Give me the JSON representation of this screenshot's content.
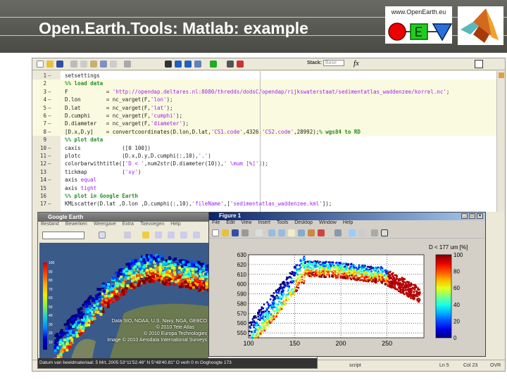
{
  "slide": {
    "title": "Open.Earth.Tools: Matlab: example",
    "logo_text": "www.OpenEarth.eu"
  },
  "editor": {
    "toolbar": {
      "stack_label": "Stack:",
      "stack_value": "Base",
      "fx": "fx"
    },
    "lines": [
      {
        "n": "1",
        "dash": "—",
        "cell": false,
        "seg": [
          [
            "setsettings",
            ""
          ]
        ]
      },
      {
        "n": "2",
        "dash": "",
        "cell": true,
        "seg": [
          [
            "%% load data",
            "cm"
          ]
        ]
      },
      {
        "n": "3",
        "dash": "—",
        "cell": true,
        "seg": [
          [
            "F            = ",
            ""
          ],
          [
            "'http://opendap.deltares.nl:8080/thredds/dodsC/opendap/rijkswaterstaat/sedimentatlas_waddenzee/korrel.nc'",
            "st"
          ],
          [
            ";",
            ""
          ]
        ]
      },
      {
        "n": "4",
        "dash": "—",
        "cell": true,
        "seg": [
          [
            "D.lon        = nc_varget(F,",
            ""
          ],
          [
            "'lon'",
            "st"
          ],
          [
            ");",
            ""
          ]
        ]
      },
      {
        "n": "5",
        "dash": "—",
        "cell": true,
        "seg": [
          [
            "D.lat        = nc_varget(F,",
            ""
          ],
          [
            "'lat'",
            "st"
          ],
          [
            ");",
            ""
          ]
        ]
      },
      {
        "n": "6",
        "dash": "—",
        "cell": true,
        "seg": [
          [
            "D.cumphi     = nc_varget(F,",
            ""
          ],
          [
            "'cumphi'",
            "st"
          ],
          [
            ");",
            ""
          ]
        ]
      },
      {
        "n": "7",
        "dash": "—",
        "cell": true,
        "seg": [
          [
            "D.diameter   = nc_varget(F,",
            ""
          ],
          [
            "'diameter'",
            "st"
          ],
          [
            ");",
            ""
          ]
        ]
      },
      {
        "n": "8",
        "dash": "—",
        "cell": true,
        "seg": [
          [
            "[D.x,D.y]    = convertcoordinates(D.lon,D.lat,",
            ""
          ],
          [
            "'CS1.code'",
            "st"
          ],
          [
            ",4326,",
            ""
          ],
          [
            "'CS2.code'",
            "st"
          ],
          [
            ",28992);",
            ""
          ],
          [
            "% wgs84 to RD",
            "cm"
          ]
        ]
      },
      {
        "n": "9",
        "dash": "",
        "cell": false,
        "seg": [
          [
            "%% plot data",
            "cm"
          ]
        ]
      },
      {
        "n": "10",
        "dash": "—",
        "cell": false,
        "seg": [
          [
            "caxis             ([0 100])",
            ""
          ]
        ]
      },
      {
        "n": "11",
        "dash": "—",
        "cell": false,
        "seg": [
          [
            "plotc             (D.x,D.y,D.cumphi(:,10),",
            ""
          ],
          [
            "'.'",
            "st"
          ],
          [
            ")",
            ""
          ]
        ]
      },
      {
        "n": "12",
        "dash": "—",
        "cell": false,
        "seg": [
          [
            "colorbarwithtitle([",
            ""
          ],
          [
            "'D < '",
            "st"
          ],
          [
            ",num2str(D.diameter(10)),",
            ""
          ],
          [
            "' \\mum [%]'",
            "st"
          ],
          [
            "]);",
            ""
          ]
        ]
      },
      {
        "n": "13",
        "dash": "",
        "cell": false,
        "seg": [
          [
            "tickmap           (",
            ""
          ],
          [
            "'xy'",
            "st"
          ],
          [
            ")",
            ""
          ]
        ]
      },
      {
        "n": "14",
        "dash": "—",
        "cell": false,
        "seg": [
          [
            "axis ",
            ""
          ],
          [
            "equal",
            "kw"
          ]
        ]
      },
      {
        "n": "15",
        "dash": "",
        "cell": false,
        "seg": [
          [
            "axis ",
            ""
          ],
          [
            "tight",
            "kw"
          ]
        ]
      },
      {
        "n": "16",
        "dash": "",
        "cell": false,
        "seg": [
          [
            "%% plot in Google Earth",
            "cm"
          ]
        ]
      },
      {
        "n": "17",
        "dash": "—",
        "cell": false,
        "seg": [
          [
            "KMLscatter(D.lat ,D.lon ,D.cumphi(:,10),",
            ""
          ],
          [
            "'fileName'",
            "st"
          ],
          [
            ",[",
            ""
          ],
          [
            "'sedimentatlas_waddenzee.kml'",
            "st"
          ],
          [
            "]);",
            ""
          ]
        ]
      }
    ],
    "status": {
      "mode": "script",
      "ln": "Ln  5",
      "col": "Col  23",
      "ovr": "OVR"
    }
  },
  "google_earth": {
    "title": "Google Earth",
    "menu": [
      "Bestand",
      "Bewerken",
      "Weergave",
      "Extra",
      "Toevoegen",
      "Help"
    ],
    "legend": [
      "100",
      "90",
      "80",
      "70",
      "60",
      "50",
      "40",
      "30",
      "20",
      "10"
    ],
    "attribution": [
      "Data SIO, NOAA, U.S. Navy, NGA, GEBCO",
      "© 2010 Tele Atlas",
      "© 2010 Europa Technologies",
      "Image © 2010 Aerodata International Surveys"
    ],
    "status": "Datum van beeldmateriaal: 5 Mrt, 2005   53°11'52.46\" N   5°48'40.81\" O   verh   0 m   Ooghoogte 173"
  },
  "figure": {
    "title": "Figure 1",
    "menu": [
      "File",
      "Edit",
      "View",
      "Insert",
      "Tools",
      "Desktop",
      "Window",
      "Help"
    ]
  },
  "chart_data": {
    "type": "scatter",
    "title": "",
    "colorbar_title": "D < 177 um [%]",
    "xlabel": "",
    "ylabel": "",
    "xlim": [
      100,
      290
    ],
    "ylim": [
      545,
      630
    ],
    "xticks": [
      "100",
      "150",
      "200",
      "250"
    ],
    "yticks": [
      "630",
      "620",
      "610",
      "600",
      "590",
      "580",
      "570",
      "560",
      "550"
    ],
    "clim": [
      0,
      100
    ],
    "cticks": [
      "0",
      "20",
      "40",
      "60",
      "80",
      "100"
    ],
    "grid": true
  }
}
